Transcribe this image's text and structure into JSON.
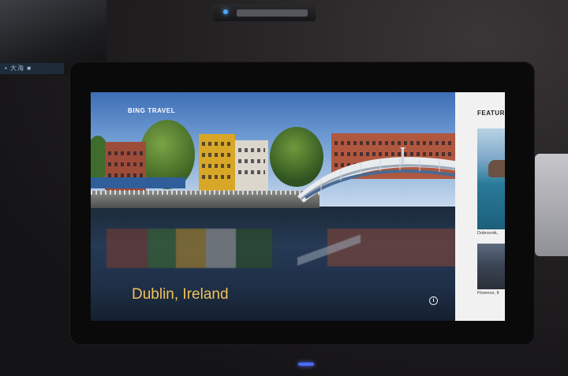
{
  "app": {
    "brand": "BING TRAVEL"
  },
  "hero": {
    "place_name": "Dublin, Ireland",
    "info_icon": "info-icon",
    "info_glyph": "i"
  },
  "sidebar": {
    "title": "FEATURE",
    "items": [
      {
        "label": "Dubrovnik,"
      },
      {
        "label": "Florence, It"
      }
    ]
  },
  "environment": {
    "left_device_text": "▪ 大海 ■"
  },
  "colors": {
    "place_text": "#f0c15a",
    "brand_text": "#ffffff",
    "sidebar_bg": "#f1f1f1",
    "webcam_led": "#4fa8ff"
  }
}
